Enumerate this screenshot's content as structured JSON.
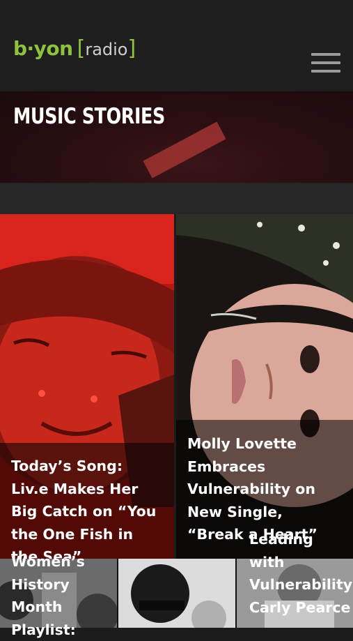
{
  "header": {
    "logo": {
      "b_yon": "b·yon",
      "open_bracket": "[",
      "radio": "radio",
      "close_bracket": "]"
    },
    "menu_icon": "hamburger-menu-icon"
  },
  "hero": {
    "title": "MUSIC STORIES"
  },
  "stories": [
    {
      "title": "Today’s Song: Liv.e Makes Her Big Catch on “You the One Fish in the Sea”"
    },
    {
      "title": "Molly Lovette Embraces Vulnerability on New Single, “Break a Heart”"
    },
    {
      "title": "Women’s History Month Playlist:"
    },
    {
      "title": "Leading with Vulnerability: Carly Pearce"
    }
  ],
  "colors": {
    "brand_green": "#8fc23f",
    "background": "#1c1c1c",
    "left_card_red": "#b31b12"
  }
}
